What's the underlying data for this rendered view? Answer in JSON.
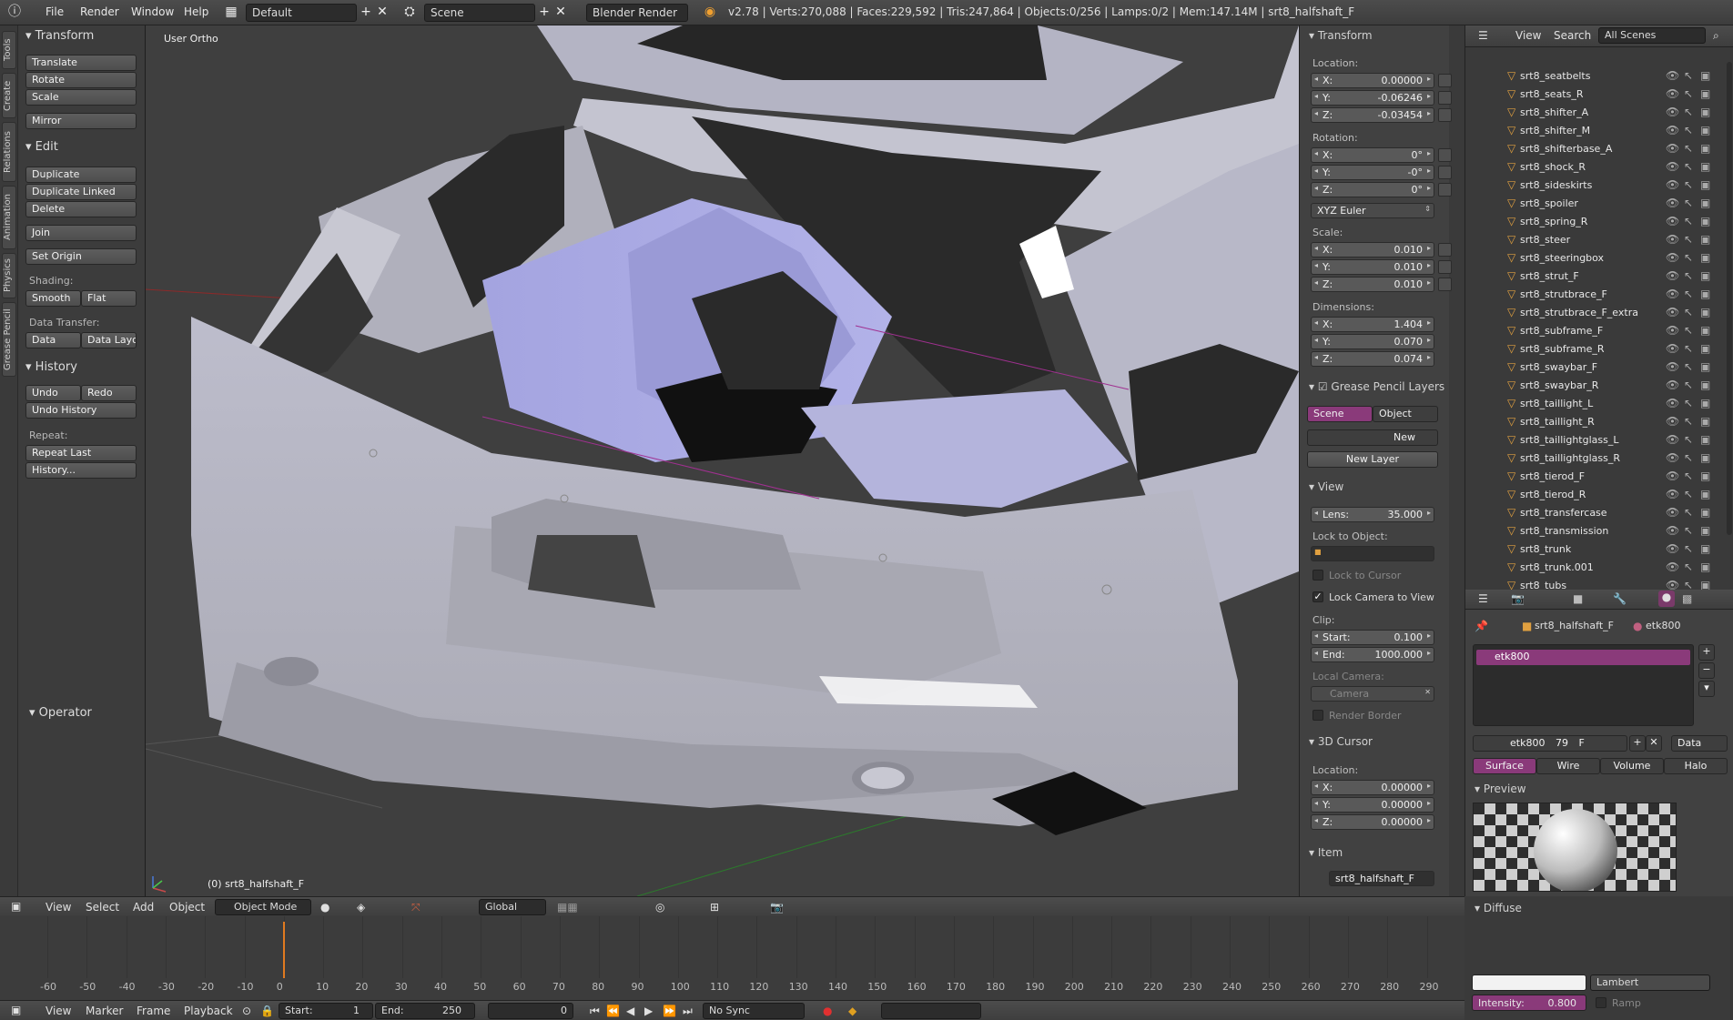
{
  "topbar": {
    "menus": [
      "File",
      "Render",
      "Window",
      "Help"
    ],
    "layout": "Default",
    "scene": "Scene",
    "engine": "Blender Render",
    "info": "v2.78 | Verts:270,088 | Faces:229,592 | Tris:247,864 | Objects:0/256 | Lamps:0/2 | Mem:147.14M | srt8_halfshaft_F"
  },
  "side_tabs": [
    "Tools",
    "Create",
    "Relations",
    "Animation",
    "Physics",
    "Grease Pencil"
  ],
  "toolshelf": {
    "transform_header": "Transform",
    "translate": "Translate",
    "rotate": "Rotate",
    "scale": "Scale",
    "mirror": "Mirror",
    "edit_header": "Edit",
    "duplicate": "Duplicate",
    "duplicate_linked": "Duplicate Linked",
    "delete": "Delete",
    "join": "Join",
    "set_origin": "Set Origin",
    "shading_label": "Shading:",
    "smooth": "Smooth",
    "flat": "Flat",
    "data_transfer_label": "Data Transfer:",
    "data": "Data",
    "data_layout": "Data Layo",
    "history_header": "History",
    "undo": "Undo",
    "redo": "Redo",
    "undo_history": "Undo History",
    "repeat_label": "Repeat:",
    "repeat_last": "Repeat Last",
    "history_btn": "History...",
    "operator_header": "Operator"
  },
  "viewport": {
    "view_name": "User Ortho",
    "object_label": "(0) srt8_halfshaft_F"
  },
  "npanel": {
    "transform_header": "Transform",
    "location_label": "Location:",
    "loc_x": "0.00000",
    "loc_y": "-0.06246",
    "loc_z": "-0.03454",
    "rotation_label": "Rotation:",
    "rot_x": "0°",
    "rot_y": "-0°",
    "rot_z": "0°",
    "rotation_mode": "XYZ Euler",
    "scale_label": "Scale:",
    "sc_x": "0.010",
    "sc_y": "0.010",
    "sc_z": "0.010",
    "dimensions_label": "Dimensions:",
    "dim_x": "1.404",
    "dim_y": "0.070",
    "dim_z": "0.074",
    "gp_header": "Grease Pencil Layers",
    "gp_scene": "Scene",
    "gp_object": "Object",
    "gp_new": "New",
    "gp_new_layer": "New Layer",
    "view_header": "View",
    "lens_label": "Lens:",
    "lens": "35.000",
    "lock_object_label": "Lock to Object:",
    "lock_cursor": "Lock to Cursor",
    "lock_camera": "Lock Camera to View",
    "clip_label": "Clip:",
    "clip_start_label": "Start:",
    "clip_start": "0.100",
    "clip_end_label": "End:",
    "clip_end": "1000.000",
    "local_camera_label": "Local Camera:",
    "camera": "Camera",
    "render_border": "Render Border",
    "cursor_header": "3D Cursor",
    "cursor_location_label": "Location:",
    "cur_x": "0.00000",
    "cur_y": "0.00000",
    "cur_z": "0.00000",
    "item_header": "Item",
    "item_name": "srt8_halfshaft_F",
    "x": "X:",
    "y": "Y:",
    "z": "Z:"
  },
  "outliner": {
    "view": "View",
    "search": "Search",
    "filter": "All Scenes",
    "items": [
      "srt8_seatbelts",
      "srt8_seats_R",
      "srt8_shifter_A",
      "srt8_shifter_M",
      "srt8_shifterbase_A",
      "srt8_shock_R",
      "srt8_sideskirts",
      "srt8_spoiler",
      "srt8_spring_R",
      "srt8_steer",
      "srt8_steeringbox",
      "srt8_strut_F",
      "srt8_strutbrace_F",
      "srt8_strutbrace_F_extra",
      "srt8_subframe_F",
      "srt8_subframe_R",
      "srt8_swaybar_F",
      "srt8_swaybar_R",
      "srt8_taillight_L",
      "srt8_taillight_R",
      "srt8_taillightglass_L",
      "srt8_taillightglass_R",
      "srt8_tierod_F",
      "srt8_tierod_R",
      "srt8_transfercase",
      "srt8_transmission",
      "srt8_trunk",
      "srt8_trunk.001",
      "srt8_tubs"
    ]
  },
  "material": {
    "object_crumb": "srt8_halfshaft_F",
    "material_crumb": "etk800",
    "slot_name": "etk800",
    "material_field": "etk800",
    "users": "79",
    "fake": "F",
    "link": "Data",
    "tabs": [
      "Surface",
      "Wire",
      "Volume",
      "Halo"
    ],
    "preview_header": "Preview",
    "diffuse_header": "Diffuse",
    "shader": "Lambert",
    "intensity_label": "Intensity:",
    "intensity": "0.800",
    "ramp": "Ramp"
  },
  "header3d": {
    "view": "View",
    "select": "Select",
    "add": "Add",
    "object": "Object",
    "mode": "Object Mode",
    "orientation": "Global"
  },
  "timeline": {
    "ticks": [
      "-60",
      "-50",
      "-40",
      "-30",
      "-20",
      "-10",
      "0",
      "10",
      "20",
      "30",
      "40",
      "50",
      "60",
      "70",
      "80",
      "90",
      "100",
      "110",
      "120",
      "130",
      "140",
      "150",
      "160",
      "170",
      "180",
      "190",
      "200",
      "210",
      "220",
      "230",
      "240",
      "250",
      "260",
      "270",
      "280",
      "290"
    ],
    "view": "View",
    "marker": "Marker",
    "frame": "Frame",
    "playback": "Playback",
    "start_label": "Start:",
    "start": "1",
    "end_label": "End:",
    "end": "250",
    "current": "0",
    "sync": "No Sync"
  }
}
